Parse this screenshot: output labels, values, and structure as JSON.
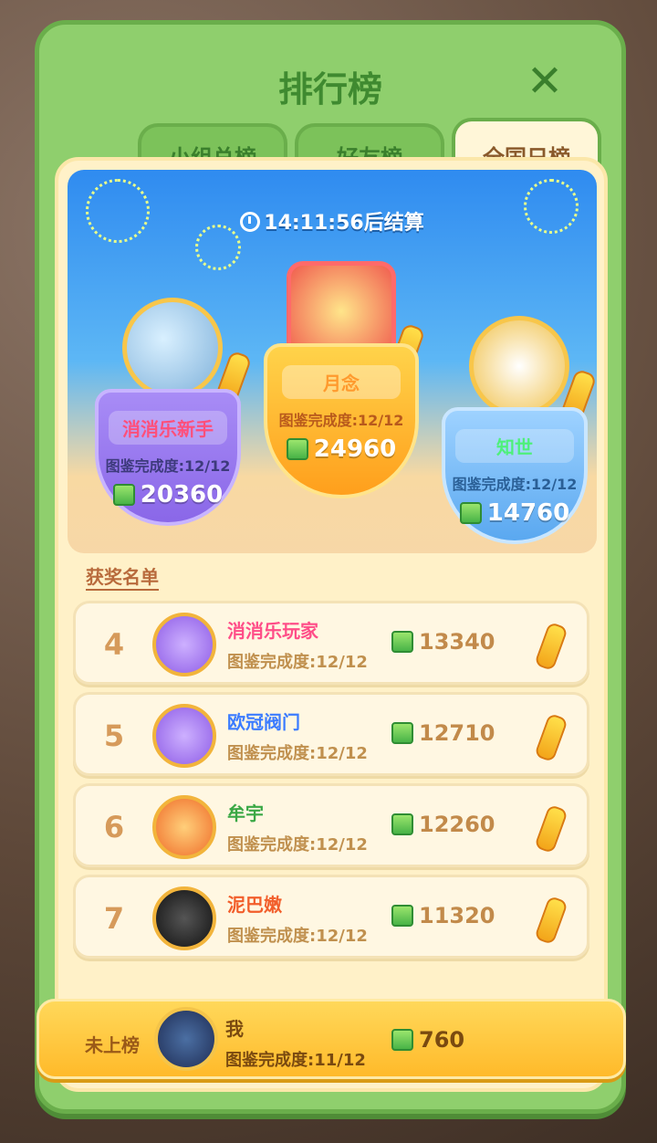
{
  "header": {
    "title": "排行榜",
    "close_icon": "close-icon"
  },
  "tabs": [
    {
      "label": "小组总榜",
      "active": false
    },
    {
      "label": "好友榜",
      "active": false
    },
    {
      "label": "全国日榜",
      "active": true
    }
  ],
  "timer": {
    "text": "14:11:56后结算"
  },
  "podium": [
    {
      "rank": 2,
      "name": "消消乐新手",
      "progress": "图鉴完成度:12/12",
      "score": "20360"
    },
    {
      "rank": 1,
      "name": "月念",
      "progress": "图鉴完成度:12/12",
      "score": "24960"
    },
    {
      "rank": 3,
      "name": "知世",
      "progress": "图鉴完成度:12/12",
      "score": "14760"
    }
  ],
  "winners_title": "获奖名单",
  "list": [
    {
      "rank": "4",
      "name": "消消乐玩家",
      "progress": "图鉴完成度:12/12",
      "score": "13340"
    },
    {
      "rank": "5",
      "name": "欧冠阀门",
      "progress": "图鉴完成度:12/12",
      "score": "12710"
    },
    {
      "rank": "6",
      "name": "牟宇",
      "progress": "图鉴完成度:12/12",
      "score": "12260"
    },
    {
      "rank": "7",
      "name": "泥巴嫩",
      "progress": "图鉴完成度:12/12",
      "score": "11320"
    }
  ],
  "self": {
    "status": "未上榜",
    "name": "我",
    "progress": "图鉴完成度:11/12",
    "score": "760"
  },
  "colors": {
    "panel": "#8fcf6d",
    "accent": "#ffba2a"
  }
}
